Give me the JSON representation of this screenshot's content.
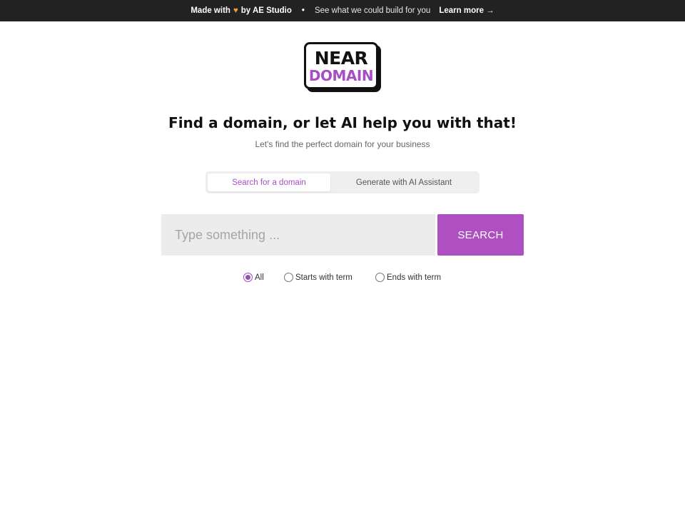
{
  "banner": {
    "made_prefix": "Made with",
    "heart_icon": "orange-heart",
    "made_suffix": "by AE Studio",
    "separator": "•",
    "tagline": "See what we could build for you",
    "learn_more": "Learn more →"
  },
  "logo": {
    "line1": "NEAR",
    "line2": "DOMAIN"
  },
  "hero": {
    "title": "Find a domain, or let AI help you with that!",
    "subtitle": "Let's find the perfect domain for your business"
  },
  "tabs": [
    {
      "label": "Search for a domain",
      "active": true
    },
    {
      "label": "Generate with AI Assistant",
      "active": false
    }
  ],
  "search": {
    "value": "",
    "placeholder": "Type something ...",
    "button_label": "SEARCH"
  },
  "match_options": [
    {
      "label": "All",
      "checked": true
    },
    {
      "label": "Starts with term",
      "checked": false
    },
    {
      "label": "Ends with term",
      "checked": false
    }
  ],
  "colors": {
    "accent": "#ae4fc2",
    "banner_bg": "#222222",
    "heart": "#f39c34"
  }
}
